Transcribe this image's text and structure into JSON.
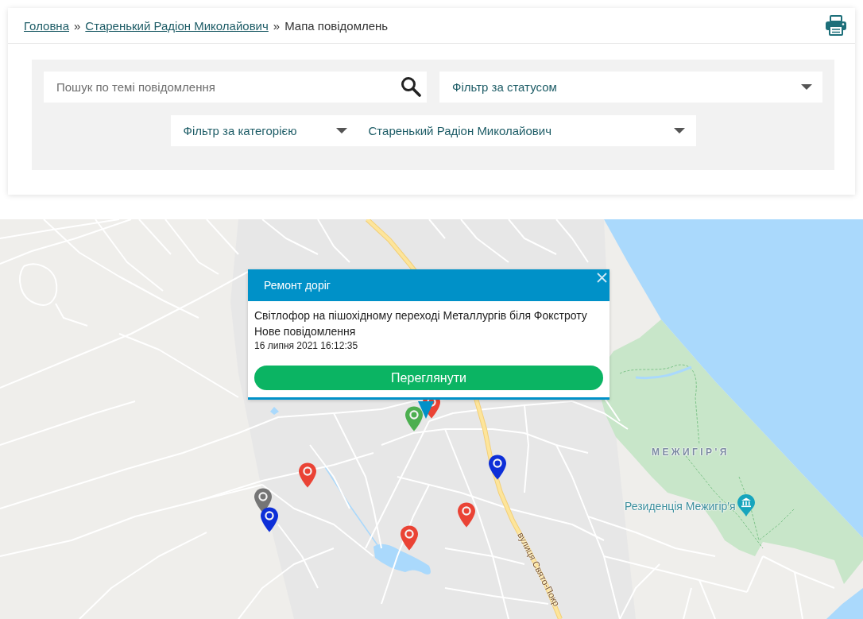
{
  "breadcrumb": [
    {
      "label": "Головна",
      "kind": "link",
      "separator": "»"
    },
    {
      "label": "Старенький Радіон Миколайович",
      "kind": "link",
      "separator": "»"
    },
    {
      "label": "Мапа повідомлень",
      "kind": "current"
    }
  ],
  "filters": {
    "search": {
      "placeholder": "Пошук по темі повідомлення"
    },
    "status_filter": {
      "value": "Фільтр за статусом"
    },
    "category_filter": {
      "value": "Фільтр за категорією"
    },
    "person_filter": {
      "value": "Старенький Радіон Миколайович"
    }
  },
  "map": {
    "labels": [
      {
        "text": "МЕЖИГІР'Я",
        "kind": "area"
      },
      {
        "text": "Резиденція Межигір'я",
        "kind": "place"
      },
      {
        "text": "вулиця Свято-Покр",
        "kind": "street"
      }
    ],
    "markers": [
      {
        "color": "#ea4335"
      },
      {
        "color": "#4caf50"
      },
      {
        "color": "#0d2fd8"
      },
      {
        "color": "#ea4335"
      },
      {
        "color": "#757575"
      },
      {
        "color": "#ea4335"
      },
      {
        "color": "#0d2fd8"
      },
      {
        "color": "#ea4335"
      }
    ],
    "popup": {
      "category": "Ремонт доріг",
      "title": "Світлофор на пішохідному переході Металлургів біля Фокстроту",
      "status": "Нове повідомлення",
      "date": "16 липня 2021 16:12:35",
      "button": "Переглянути"
    }
  }
}
